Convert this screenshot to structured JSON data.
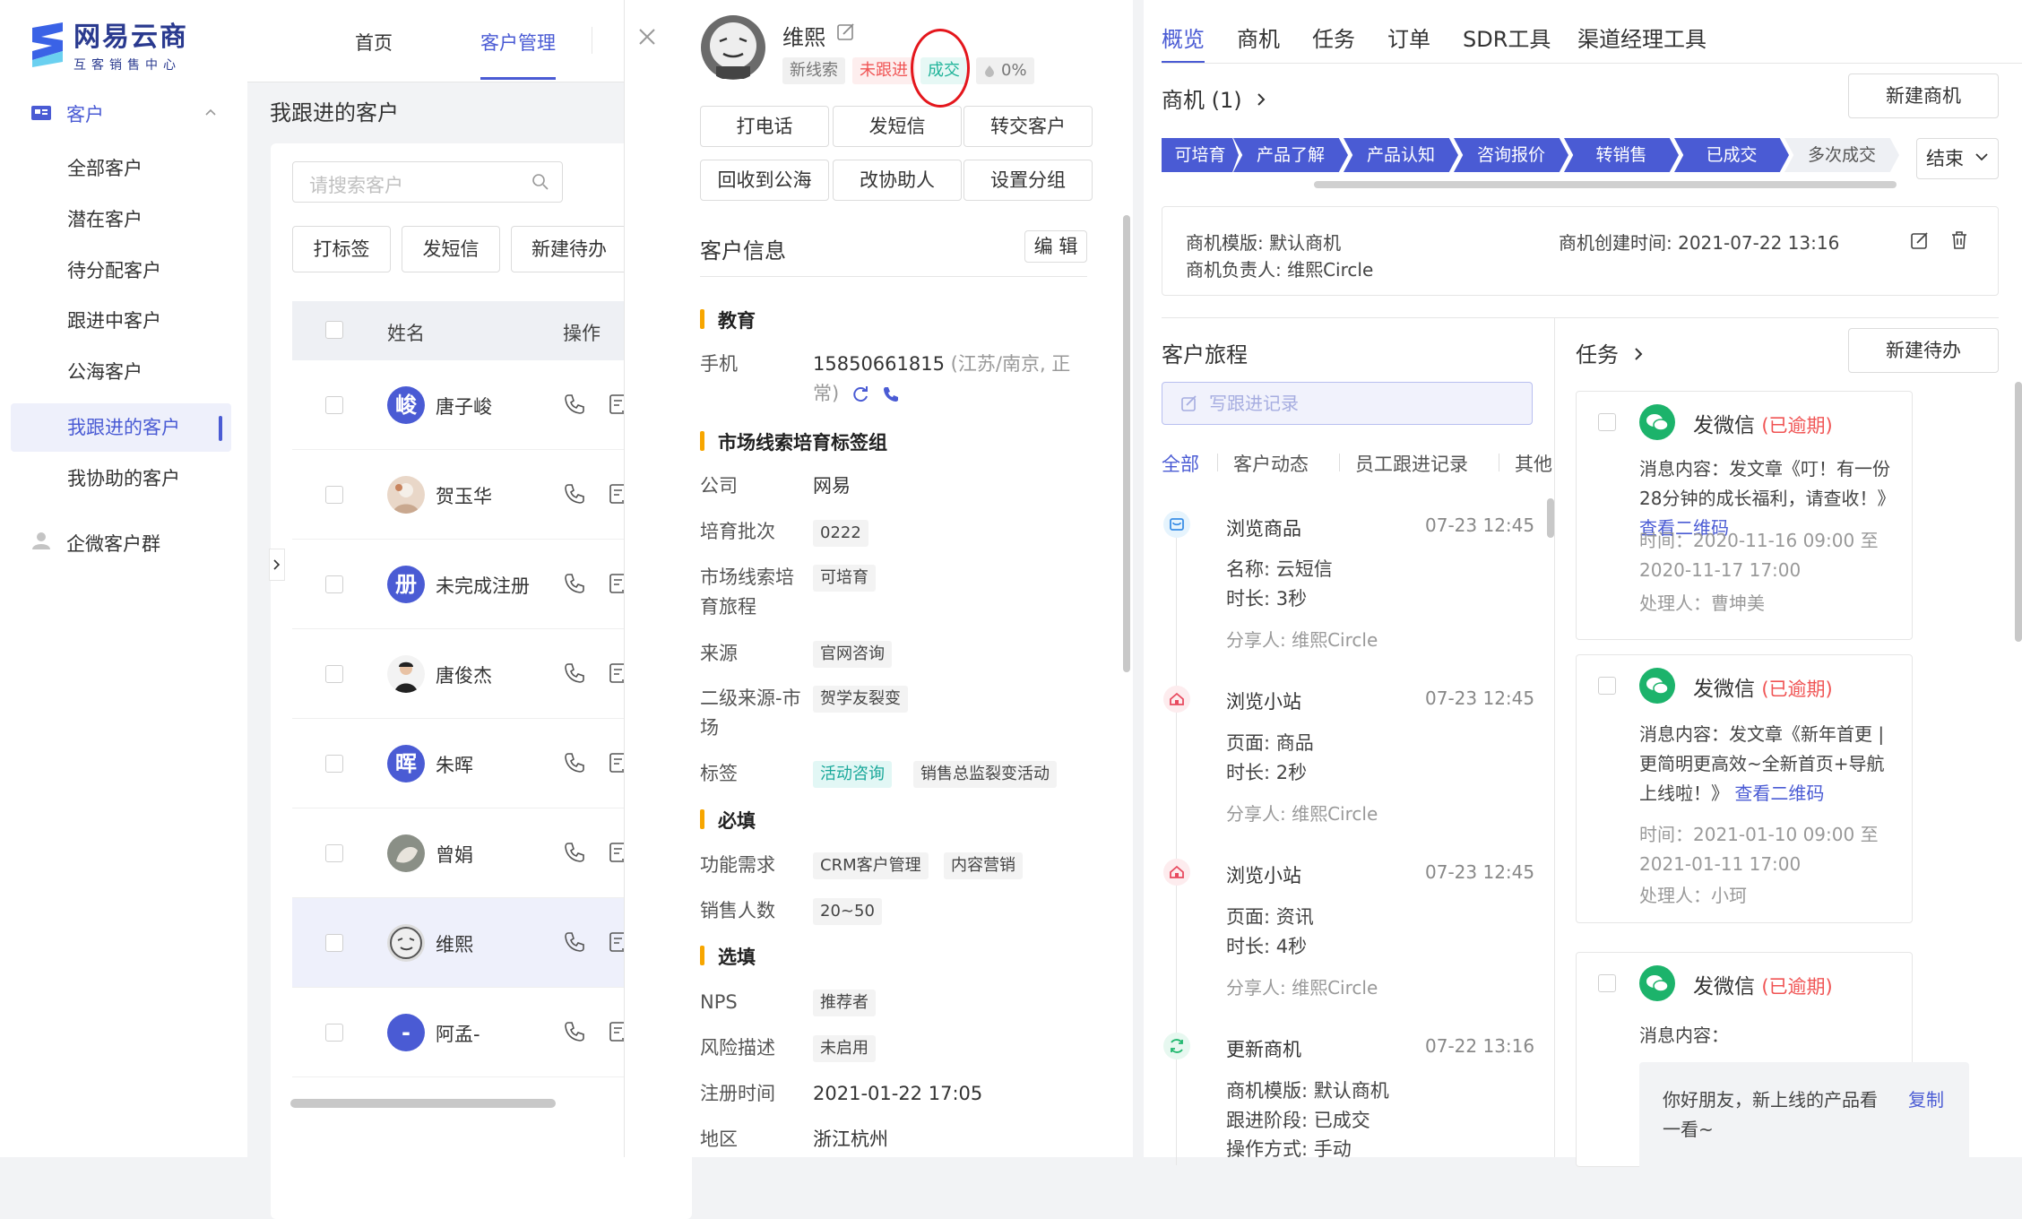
{
  "brand": {
    "title": "网易云商",
    "subtitle": "互客销售中心"
  },
  "top_tabs": [
    {
      "label": "首页"
    },
    {
      "label": "客户管理"
    }
  ],
  "sidebar": {
    "group_label": "客户",
    "items": [
      {
        "label": "全部客户"
      },
      {
        "label": "潜在客户"
      },
      {
        "label": "待分配客户"
      },
      {
        "label": "跟进中客户"
      },
      {
        "label": "公海客户"
      },
      {
        "label": "我跟进的客户"
      },
      {
        "label": "我协助的客户"
      }
    ],
    "group2_label": "企微客户群"
  },
  "list": {
    "title": "我跟进的客户",
    "search_placeholder": "请搜索客户",
    "actions": [
      "打标签",
      "发短信",
      "新建待办"
    ],
    "columns": {
      "name": "姓名",
      "ops": "操作"
    },
    "rows": [
      {
        "name": "唐子峻",
        "avatar_text": "峻"
      },
      {
        "name": "贺玉华",
        "avatar_text": ""
      },
      {
        "name": "未完成注册",
        "avatar_text": "册"
      },
      {
        "name": "唐俊杰",
        "avatar_text": ""
      },
      {
        "name": "朱晖",
        "avatar_text": "晖"
      },
      {
        "name": "曾娟",
        "avatar_text": ""
      },
      {
        "name": "维熙",
        "avatar_text": ""
      },
      {
        "name": "阿孟-",
        "avatar_text": "-"
      }
    ]
  },
  "detail": {
    "name": "维熙",
    "tags": [
      "新线索",
      "未跟进",
      "成交",
      "0%"
    ],
    "actions": [
      "打电话",
      "发短信",
      "转交客户",
      "回收到公海",
      "改协助人",
      "设置分组"
    ],
    "section_title": "客户信息",
    "edit_label": "编 辑",
    "groups": {
      "edu": "教育",
      "market": "市场线索培育标签组",
      "required": "必填",
      "optional": "选填"
    },
    "phone_label": "手机",
    "phone": "15850661815",
    "phone_note": "(江苏/南京, 正常)",
    "fields": {
      "company_label": "公司",
      "company": "网易",
      "batch_label": "培育批次",
      "batch": "0222",
      "journey_label": "市场线索培育旅程",
      "journey": "可培育",
      "source_label": "来源",
      "source": "官网咨询",
      "source2_label": "二级来源-市场",
      "source2": "贺学友裂变",
      "tag_label": "标签",
      "tag1": "活动咨询",
      "tag2": "销售总监裂变活动",
      "need_label": "功能需求",
      "need1": "CRM客户管理",
      "need2": "内容营销",
      "sales_label": "销售人数",
      "sales": "20~50",
      "nps_label": "NPS",
      "nps": "推荐者",
      "risk_label": "风险描述",
      "risk": "未启用",
      "reg_label": "注册时间",
      "reg": "2021-01-22 17:05",
      "region_label": "地区",
      "region": "浙江杭州"
    }
  },
  "right": {
    "tabs": [
      "概览",
      "商机",
      "任务",
      "订单",
      "SDR工具",
      "渠道经理工具"
    ],
    "opp_title": "商机 (1)",
    "new_opp": "新建商机",
    "stages": [
      "可培育",
      "产品了解",
      "产品认知",
      "咨询报价",
      "转销售",
      "已成交",
      "多次成交"
    ],
    "end_label": "结束",
    "opp_info": {
      "template": "商机模版:  默认商机",
      "owner": "商机负责人:  维熙Circle",
      "created": "商机创建时间:  2021-07-22 13:16"
    },
    "journey_title": "客户旅程",
    "follow_btn": "写跟进记录",
    "filters": [
      "全部",
      "客户动态",
      "员工跟进记录",
      "其他"
    ],
    "timeline": [
      {
        "title": "浏览商品",
        "time": "07-23 12:45",
        "l1": "名称:  云短信",
        "l2": "时长:  3秒",
        "share": "分享人:  维熙Circle"
      },
      {
        "title": "浏览小站",
        "time": "07-23 12:45",
        "l1": "页面:  商品",
        "l2": "时长:  2秒",
        "share": "分享人:  维熙Circle"
      },
      {
        "title": "浏览小站",
        "time": "07-23 12:45",
        "l1": "页面:  资讯",
        "l2": "时长:  4秒",
        "share": "分享人:  维熙Circle"
      },
      {
        "title": "更新商机",
        "time": "07-22 13:16",
        "l1": "商机模版:  默认商机",
        "l2": "跟进阶段:  已成交",
        "share": "操作方式:  手动"
      }
    ],
    "task_title": "任务",
    "new_task": "新建待办",
    "tasks": [
      {
        "title": "发微信",
        "overdue": "(已逾期)",
        "content": "消息内容：发文章《叮！有一份28分钟的成长福利，请查收！》",
        "link": "查看二维码",
        "time": "时间：2020-11-16 09:00 至 2020-11-17 17:00",
        "handler": "处理人：曹坤美"
      },
      {
        "title": "发微信",
        "overdue": "(已逾期)",
        "content": "消息内容：发文章《新年首更 | 更简明更高效~全新首页+导航上线啦！》",
        "link": "查看二维码",
        "time": "时间：2021-01-10 09:00 至 2021-01-11 17:00",
        "handler": "处理人：小珂"
      },
      {
        "title": "发微信",
        "overdue": "(已逾期)",
        "content": "消息内容：",
        "msg": "你好朋友，新上线的产品看一看~",
        "copy": "复制"
      }
    ]
  },
  "colors": {
    "primary": "#4a5bd4",
    "overdue": "#f05454",
    "wechat": "#1cb36b",
    "highlight_circle": "#e4161c"
  }
}
